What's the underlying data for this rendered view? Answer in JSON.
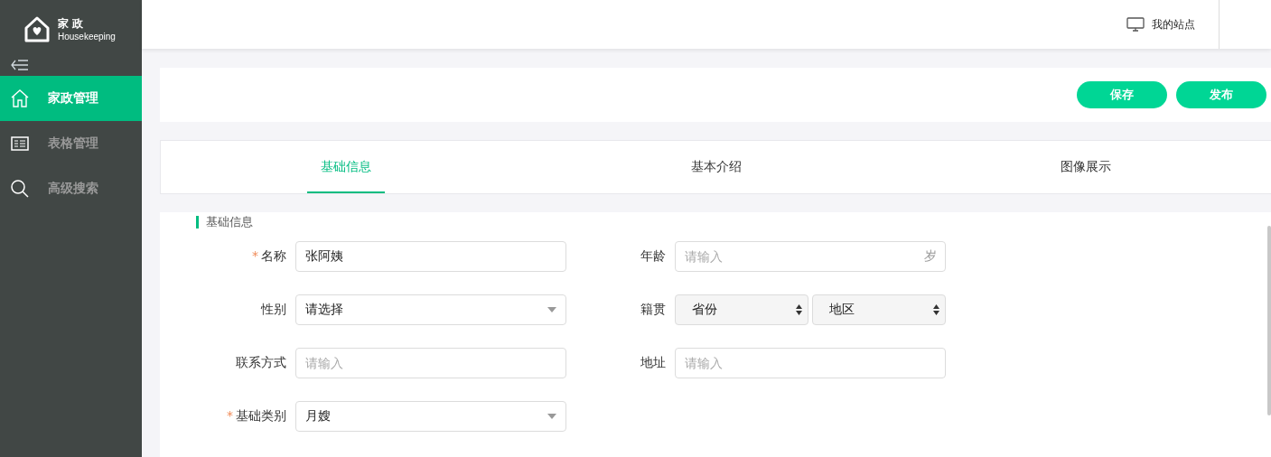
{
  "logo": {
    "title": "家 政",
    "subtitle": "Housekeeping"
  },
  "sidebar": {
    "items": [
      {
        "label": "家政管理",
        "kind": "home",
        "selected": true
      },
      {
        "label": "表格管理",
        "kind": "list",
        "selected": false
      },
      {
        "label": "高级搜索",
        "kind": "search",
        "selected": false
      }
    ]
  },
  "header": {
    "site_link": "我的站点"
  },
  "actions": [
    "保存",
    "发布"
  ],
  "tabs": [
    {
      "label": "基础信息",
      "selected": true
    },
    {
      "label": "基本介绍",
      "selected": false
    },
    {
      "label": "图像展示",
      "selected": false
    }
  ],
  "section": {
    "title": "基础信息"
  },
  "fields": [
    {
      "label": "名称",
      "required_mark": "*",
      "kind": "input",
      "value": "张阿姨"
    },
    {
      "label": "年龄",
      "kind": "input",
      "placeholder": "请输入",
      "suffix": "岁"
    },
    {
      "label": "性别",
      "kind": "select",
      "value": "请选择"
    },
    {
      "label": "籍贯",
      "kind": "dual-select",
      "options": [
        "省份",
        "地区"
      ]
    },
    {
      "label": "联系方式",
      "kind": "input",
      "placeholder": "请输入"
    },
    {
      "label": "地址",
      "kind": "input",
      "placeholder": "请输入"
    },
    {
      "label": "基础类别",
      "required_mark": "*",
      "kind": "select",
      "value": "月嫂"
    }
  ]
}
